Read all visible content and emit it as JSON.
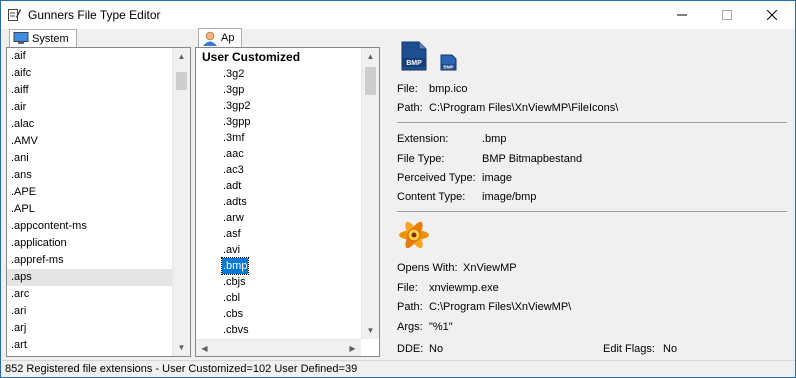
{
  "window": {
    "title": "Gunners File Type Editor"
  },
  "tabs": {
    "system": "System",
    "ap": "Ap"
  },
  "extensions": [
    ".aif",
    ".aifc",
    ".aiff",
    ".air",
    ".alac",
    ".AMV",
    ".ani",
    ".ans",
    ".APE",
    ".APL",
    ".appcontent-ms",
    ".application",
    ".appref-ms",
    ".aps",
    ".arc",
    ".ari",
    ".arj",
    ".art"
  ],
  "selected_extension": ".aps",
  "user_customized": {
    "header": "User Customized",
    "items": [
      ".3g2",
      ".3gp",
      ".3gp2",
      ".3gpp",
      ".3mf",
      ".aac",
      ".ac3",
      ".adt",
      ".adts",
      ".arw",
      ".asf",
      ".avi",
      ".bmp",
      ".cbjs",
      ".cbl",
      ".cbs",
      ".cbvs"
    ],
    "selected": ".bmp"
  },
  "icon_info": {
    "badge_large": "BMP",
    "badge_small": "BMP",
    "file_label": "File:",
    "file": "bmp.ico",
    "path_label": "Path:",
    "path": "C:\\Program Files\\XnViewMP\\FileIcons\\"
  },
  "type_info": {
    "extension_label": "Extension:",
    "extension": ".bmp",
    "file_type_label": "File Type:",
    "file_type": "BMP Bitmapbestand",
    "perceived_label": "Perceived Type:",
    "perceived": "image",
    "content_label": "Content Type:",
    "content": "image/bmp"
  },
  "open_with": {
    "label": "Opens With:",
    "app": "XnViewMP",
    "file_label": "File:",
    "file": "xnviewmp.exe",
    "path_label": "Path:",
    "path": "C:\\Program Files\\XnViewMP\\",
    "args_label": "Args:",
    "args": "\"%1\"",
    "dde_label": "DDE:",
    "dde": "No",
    "edit_flags_label": "Edit Flags:",
    "edit_flags": "No"
  },
  "status": "852 Registered file extensions - User Customized=102  User Defined=39",
  "colors": {
    "selection": "#0078d7",
    "window_border": "#1f6fb4",
    "icon_blue": "#1d4f91",
    "xnview_orange": "#f39200"
  }
}
